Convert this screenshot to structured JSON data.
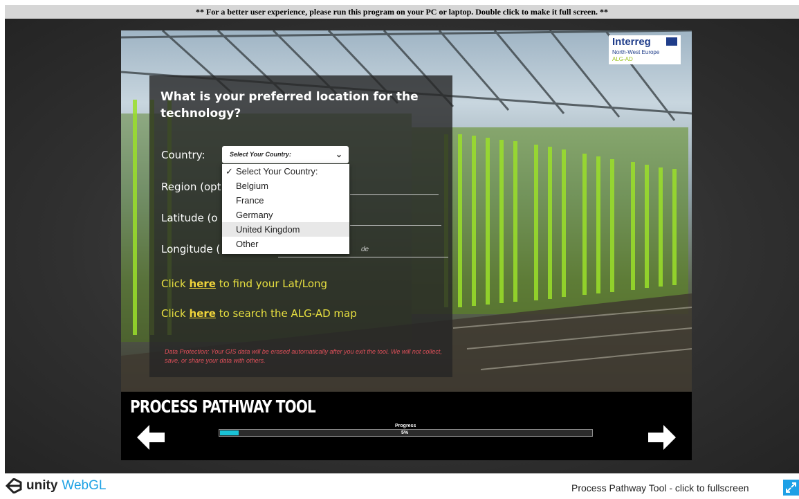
{
  "notice": "** For a better user experience, please run this program on your PC or laptop. Double click to make it full screen. **",
  "logo": {
    "line1": "Interreg",
    "line2": "North-West Europe",
    "line3": "ALG-AD"
  },
  "question": {
    "title": "What is your preferred location for the technology?"
  },
  "form": {
    "country_label": "Country:",
    "region_label": "Region (opt",
    "latitude_label": "Latitude (o",
    "longitude_label": "Longitude (",
    "longitude_hint": "de",
    "country_select_value": "Select Your Country:",
    "country_options": [
      "Select Your Country:",
      "Belgium",
      "France",
      "Germany",
      "United Kingdom",
      "Other"
    ],
    "selected_option": "Select Your Country:",
    "hovered_option": "United Kingdom"
  },
  "links": {
    "latlong_prefix": "Click ",
    "latlong_link": "here",
    "latlong_suffix": " to find your Lat/Long",
    "map_prefix": "Click ",
    "map_link": "here",
    "map_suffix": " to search the ALG-AD map"
  },
  "data_protection": "Data Protection: Your GIS data will be erased automatically after you exit the tool. We will not collect, save, or share your data with others.",
  "footer": {
    "tool_title": "PROCESS PATHWAY TOOL",
    "progress_label": "Progress",
    "progress_percent_text": "5%",
    "progress_fraction": 0.05
  },
  "page_footer": {
    "unity_brand": "unity",
    "webgl": "WebGL",
    "fullscreen_text": "Process Pathway Tool - click to fullscreen"
  },
  "icons": [
    "arrow-left-icon",
    "arrow-right-icon",
    "unity-logo-icon",
    "fullscreen-icon",
    "chevron-down-icon",
    "checkmark-icon",
    "eu-flag-icon"
  ],
  "colors": {
    "accent": "#19c2d6",
    "link_yellow": "#f0d43a",
    "warning_red": "#e0505a",
    "webgl_blue": "#1da1e4"
  }
}
